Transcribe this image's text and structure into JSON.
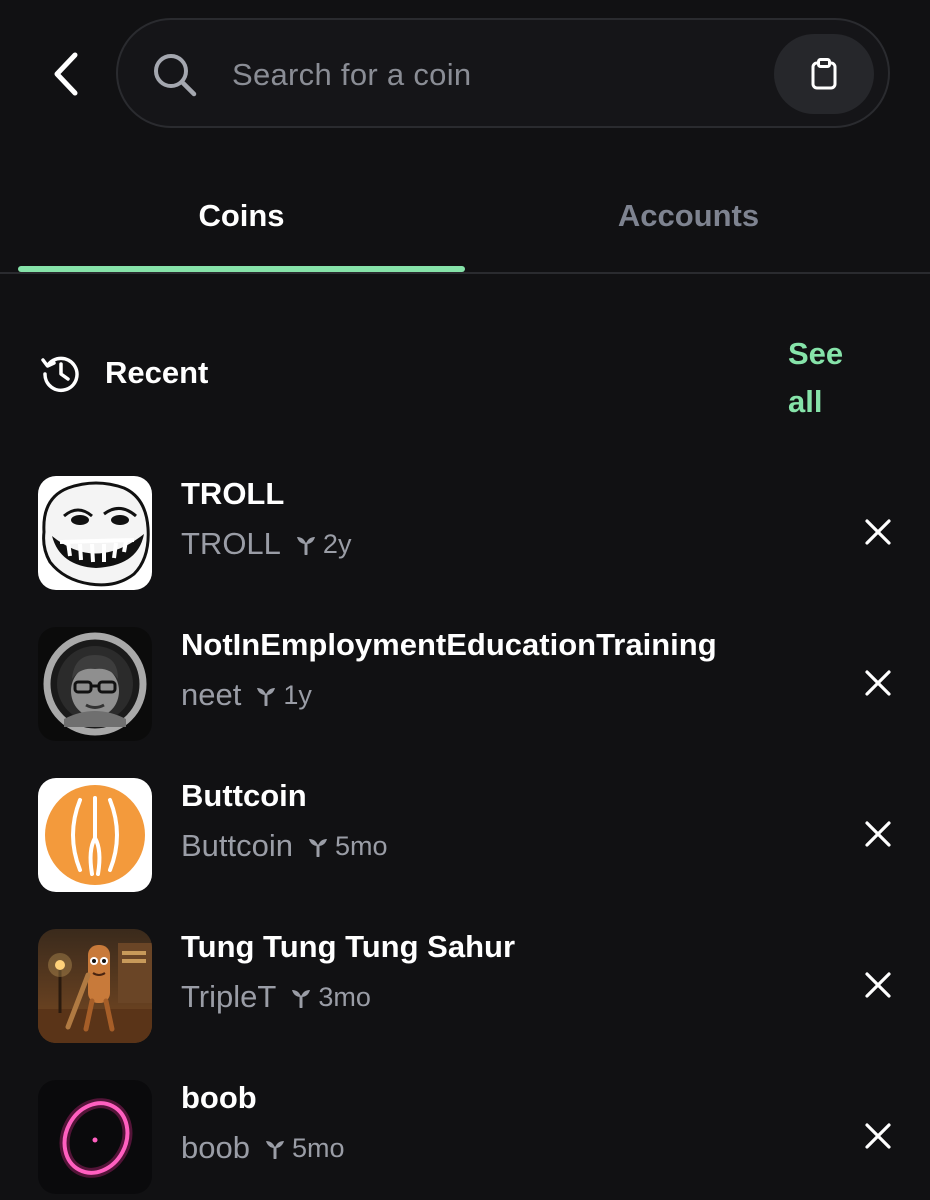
{
  "header": {
    "back_icon": "chevron-left-icon",
    "search": {
      "icon": "search-icon",
      "placeholder": "Search for a coin",
      "value": "",
      "paste_icon": "clipboard-icon"
    }
  },
  "tabs": [
    {
      "label": "Coins",
      "active": true
    },
    {
      "label": "Accounts",
      "active": false
    }
  ],
  "recent": {
    "icon": "history-icon",
    "title": "Recent",
    "see_all_label": "See all"
  },
  "coins": [
    {
      "name": "TROLL",
      "ticker": "TROLL",
      "age": "2y",
      "avatar": "troll-face"
    },
    {
      "name": "NotInEmploymentEducationTraining",
      "ticker": "neet",
      "age": "1y",
      "avatar": "neet-portrait"
    },
    {
      "name": "Buttcoin",
      "ticker": "Buttcoin",
      "age": "5mo",
      "avatar": "buttcoin-logo"
    },
    {
      "name": "Tung Tung Tung Sahur",
      "ticker": "TripleT",
      "age": "3mo",
      "avatar": "tung-tung-character"
    },
    {
      "name": "boob",
      "ticker": "boob",
      "age": "5mo",
      "avatar": "neon-circle"
    }
  ],
  "colors": {
    "background": "#111113",
    "accent": "#86e3a9",
    "muted_text": "#9a9da6",
    "inactive_tab": "#7e8390"
  }
}
